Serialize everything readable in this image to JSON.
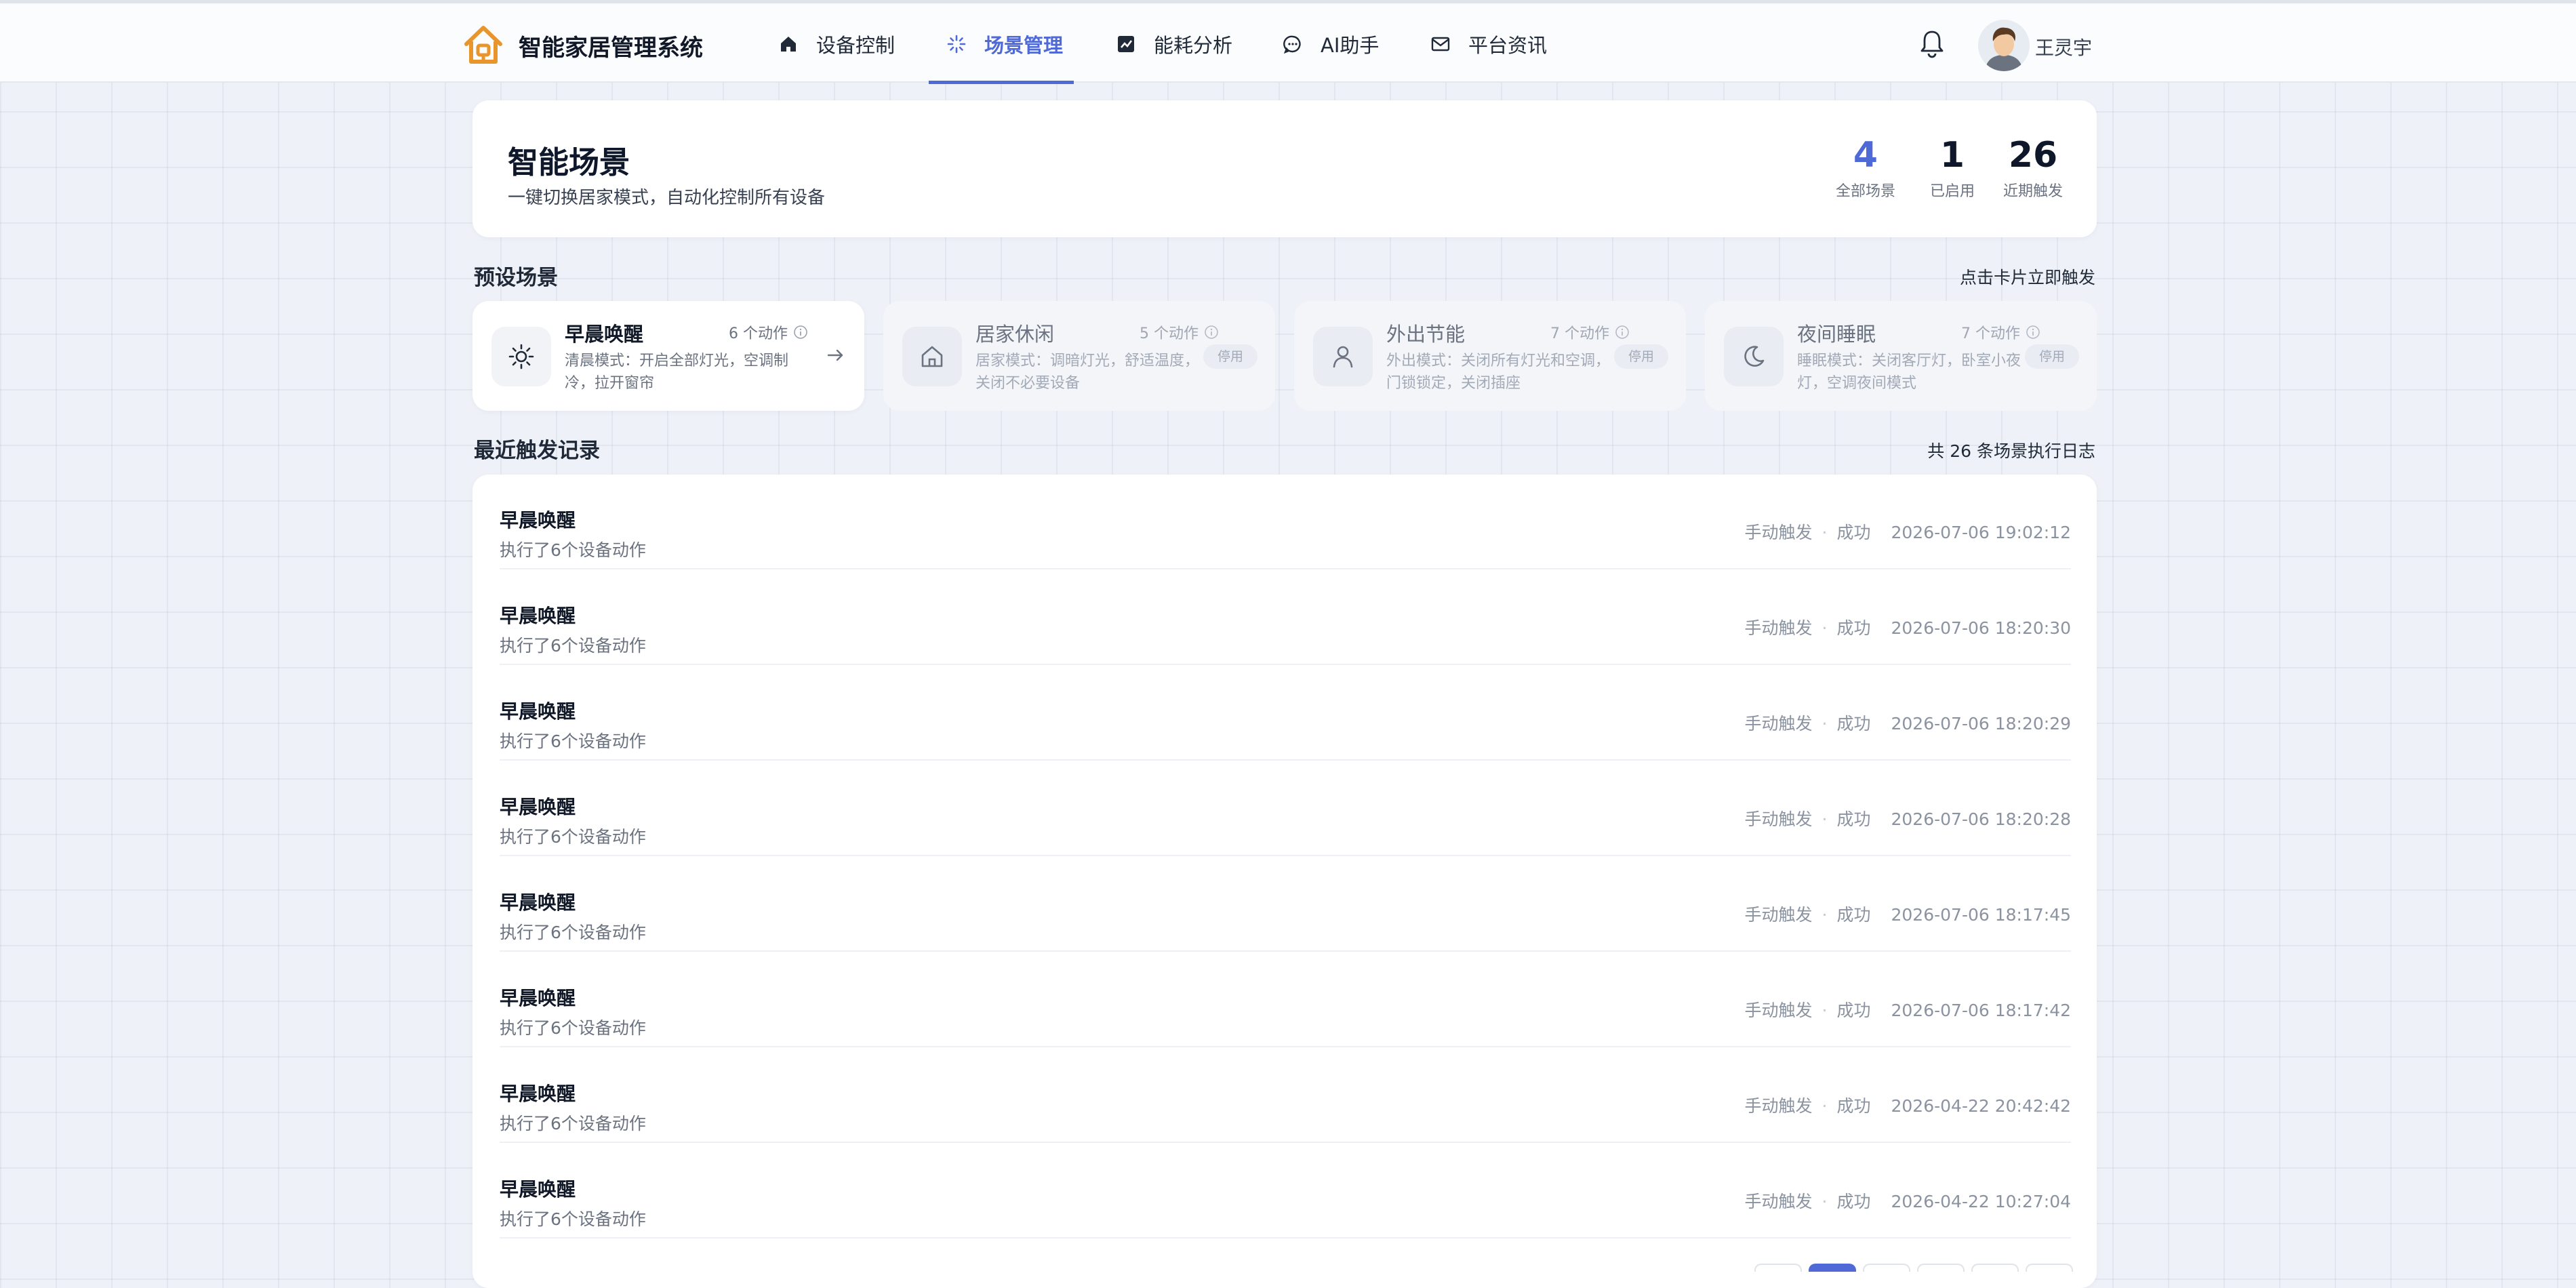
{
  "brand": {
    "name": "智能家居管理系统"
  },
  "nav": {
    "items": [
      {
        "label": "设备控制",
        "icon": "home-icon"
      },
      {
        "label": "场景管理",
        "icon": "sparkle-icon",
        "active": true
      },
      {
        "label": "能耗分析",
        "icon": "chart-icon"
      },
      {
        "label": "AI助手",
        "icon": "chat-icon"
      },
      {
        "label": "平台资讯",
        "icon": "mail-icon"
      }
    ]
  },
  "user": {
    "name": "王灵宇",
    "notification_icon": "bell-icon"
  },
  "hero": {
    "title": "智能场景",
    "subtitle": "一键切换居家模式，自动化控制所有设备",
    "stats": [
      {
        "value": "4",
        "label": "全部场景"
      },
      {
        "value": "1",
        "label": "已启用"
      },
      {
        "value": "26",
        "label": "近期触发"
      }
    ]
  },
  "presets": {
    "title": "预设场景",
    "hint": "点击卡片立即触发",
    "scenes": [
      {
        "name": "早晨唤醒",
        "count": "6 个动作",
        "desc": "清晨模式：开启全部灯光，空调制冷，拉开窗帘",
        "icon": "sun-icon",
        "enabled": true
      },
      {
        "name": "居家休闲",
        "count": "5 个动作",
        "desc": "居家模式：调暗灯光，舒适温度，关闭不必要设备",
        "icon": "house-icon",
        "badge": "停用"
      },
      {
        "name": "外出节能",
        "count": "7 个动作",
        "desc": "外出模式：关闭所有灯光和空调，门锁锁定，关闭插座",
        "icon": "person-icon",
        "badge": "停用"
      },
      {
        "name": "夜间睡眠",
        "count": "7 个动作",
        "desc": "睡眠模式：关闭客厅灯，卧室小夜灯，空调夜间模式",
        "icon": "moon-icon",
        "badge": "停用"
      }
    ]
  },
  "logs": {
    "title": "最近触发记录",
    "summary": "共 26 条场景执行日志",
    "rows": [
      {
        "title": "早晨唤醒",
        "sub": "执行了6个设备动作",
        "trigger": "手动触发",
        "status": "成功",
        "time": "2026-07-06 19:02:12"
      },
      {
        "title": "早晨唤醒",
        "sub": "执行了6个设备动作",
        "trigger": "手动触发",
        "status": "成功",
        "time": "2026-07-06 18:20:30"
      },
      {
        "title": "早晨唤醒",
        "sub": "执行了6个设备动作",
        "trigger": "手动触发",
        "status": "成功",
        "time": "2026-07-06 18:20:29"
      },
      {
        "title": "早晨唤醒",
        "sub": "执行了6个设备动作",
        "trigger": "手动触发",
        "status": "成功",
        "time": "2026-07-06 18:20:28"
      },
      {
        "title": "早晨唤醒",
        "sub": "执行了6个设备动作",
        "trigger": "手动触发",
        "status": "成功",
        "time": "2026-07-06 18:17:45"
      },
      {
        "title": "早晨唤醒",
        "sub": "执行了6个设备动作",
        "trigger": "手动触发",
        "status": "成功",
        "time": "2026-07-06 18:17:42"
      },
      {
        "title": "早晨唤醒",
        "sub": "执行了6个设备动作",
        "trigger": "手动触发",
        "status": "成功",
        "time": "2026-04-22 20:42:42"
      },
      {
        "title": "早晨唤醒",
        "sub": "执行了6个设备动作",
        "trigger": "手动触发",
        "status": "成功",
        "time": "2026-04-22 10:27:04"
      }
    ]
  },
  "colors": {
    "accent": "#4f6ad6",
    "logo": "#e8952c",
    "background": "#eef1f7"
  }
}
